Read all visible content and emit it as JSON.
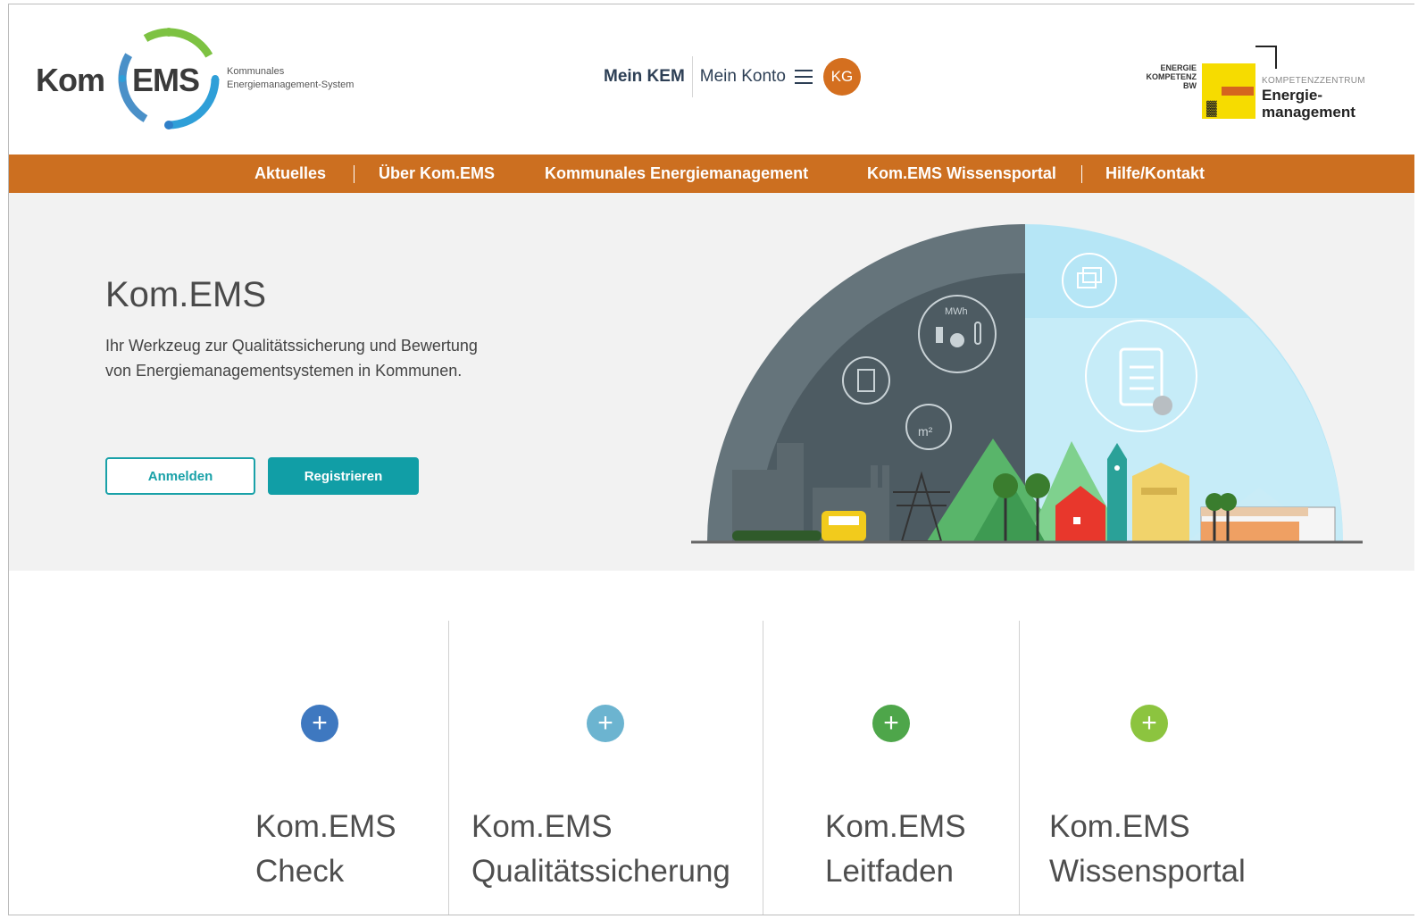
{
  "header": {
    "logo_kom": "Kom",
    "logo_ems": "EMS",
    "logo_sub_line1": "Kommunales",
    "logo_sub_line2": "Energiemanagement-System",
    "mein_kem": "Mein KEM",
    "mein_konto": "Mein Konto",
    "avatar_initials": "KG",
    "partner": {
      "energie_label_line1": "ENERGIE",
      "energie_label_line2": "KOMPETENZ",
      "energie_label_line3": "BW",
      "kompetenzzentrum": "KOMPETENZZENTRUM",
      "energie_line1": "Energie-",
      "energie_line2": "management"
    }
  },
  "nav": {
    "items": [
      {
        "label": "Aktuelles"
      },
      {
        "label": "Über Kom.EMS"
      },
      {
        "label": "Kommunales Energiemanagement"
      },
      {
        "label": "Kom.EMS Wissensportal"
      },
      {
        "label": "Hilfe/Kontakt"
      }
    ]
  },
  "hero": {
    "title": "Kom.EMS",
    "text_line1": "Ihr Werkzeug zur Qualitätssicherung und Bewertung",
    "text_line2": "von Energiemanagementsystemen in Kommunen.",
    "login_label": "Anmelden",
    "register_label": "Registrieren",
    "illustration_text_mwh": "MWh",
    "illustration_text_m2": "m²"
  },
  "tiles": [
    {
      "line1": "Kom.EMS",
      "line2": "Check",
      "color": "#3e78c0"
    },
    {
      "line1": "Kom.EMS",
      "line2": "Qualitätssicherung",
      "color": "#6cb4d0"
    },
    {
      "line1": "Kom.EMS",
      "line2": "Leitfaden",
      "color": "#4ea64a"
    },
    {
      "line1": "Kom.EMS",
      "line2": "Wissensportal",
      "color": "#8cc43f"
    }
  ],
  "colors": {
    "nav_bg": "#cc6f20",
    "accent_teal": "#119ea6",
    "avatar_bg": "#d46f1f"
  }
}
